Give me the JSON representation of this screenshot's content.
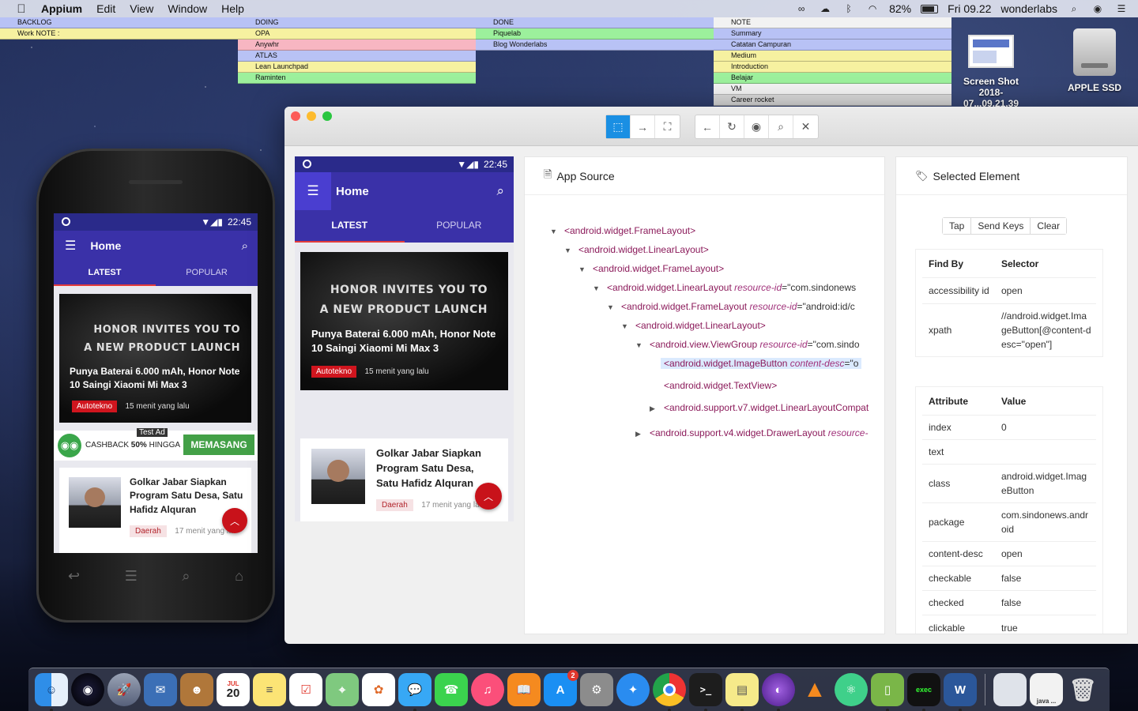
{
  "menubar": {
    "app_name": "Appium",
    "menus": [
      "Edit",
      "View",
      "Window",
      "Help"
    ],
    "battery": "82%",
    "clock": "Fri 09.22",
    "user": "wonderlabs"
  },
  "stickies": [
    {
      "header": "BACKLOG",
      "rows": [
        {
          "text": "Work NOTE :",
          "color": "yellow"
        }
      ]
    },
    {
      "header": "DOING",
      "rows": [
        {
          "text": "OPA",
          "color": "yellow"
        },
        {
          "text": "Anywhr",
          "color": "pink"
        },
        {
          "text": "ATLAS",
          "color": "blue"
        },
        {
          "text": "Lean Launchpad",
          "color": "yellow"
        },
        {
          "text": "Raminten",
          "color": "green"
        }
      ]
    },
    {
      "header": "DONE",
      "rows": [
        {
          "text": "Piquelab",
          "color": "green"
        },
        {
          "text": "Blog Wonderlabs",
          "color": "blue"
        }
      ]
    },
    {
      "header": "NOTE",
      "rows": [
        {
          "text": "Summary",
          "color": "blue"
        },
        {
          "text": "Catatan Campuran",
          "color": "blue"
        },
        {
          "text": "Medium",
          "color": "yellow"
        },
        {
          "text": "Introduction",
          "color": "yellow"
        },
        {
          "text": "Belajar",
          "color": "green"
        },
        {
          "text": "VM",
          "color": "white"
        },
        {
          "text": "Career rocket",
          "color": "gray"
        }
      ]
    }
  ],
  "desktop_icons": {
    "screenshot_line1": "Screen Shot",
    "screenshot_line2": "2018-07...09.21.39",
    "disk": "APPLE SSD"
  },
  "app": {
    "status_time": "22:45",
    "title": "Home",
    "tabs": [
      "LATEST",
      "POPULAR"
    ],
    "promo_line1": "HONOR INVITES YOU TO",
    "promo_line2": "A NEW PRODUCT LAUNCH",
    "headline": "Punya Baterai 6.000 mAh, Honor Note 10 Saingi Xiaomi Mi Max 3",
    "hero_badge": "Autotekno",
    "hero_time": "15 menit yang lalu",
    "ad_label": "Test Ad",
    "ad_text_prefix": "CASHBACK",
    "ad_text_bold": "50%",
    "ad_text_suffix": "HINGGA",
    "ad_button": "MEMASANG",
    "card_title": "Golkar Jabar Siapkan Program Satu Desa, Satu Hafidz Alquran",
    "card_badge": "Daerah",
    "card_time_phone": "17 menit yang la",
    "card_time_preview": "17 menit yang la"
  },
  "inspector": {
    "source_title": "App Source",
    "selected_title": "Selected Element",
    "actions": [
      "Tap",
      "Send Keys",
      "Clear"
    ],
    "findby_headers": {
      "k": "Find By",
      "v": "Selector"
    },
    "findby": [
      {
        "k": "accessibility id",
        "v": "open"
      },
      {
        "k": "xpath",
        "v": "//android.widget.ImageButton[@content-desc=\"open\"]"
      }
    ],
    "attr_headers": {
      "k": "Attribute",
      "v": "Value"
    },
    "attributes": [
      {
        "k": "index",
        "v": "0"
      },
      {
        "k": "text",
        "v": ""
      },
      {
        "k": "class",
        "v": "android.widget.ImageButton"
      },
      {
        "k": "package",
        "v": "com.sindonews.android"
      },
      {
        "k": "content-desc",
        "v": "open"
      },
      {
        "k": "checkable",
        "v": "false"
      },
      {
        "k": "checked",
        "v": "false"
      },
      {
        "k": "clickable",
        "v": "true"
      }
    ],
    "tree": [
      {
        "caret": "▼",
        "tag": "<android.widget.FrameLayout>",
        "attr": "",
        "val": ""
      },
      {
        "caret": "▼",
        "tag": "<android.widget.LinearLayout>",
        "attr": "",
        "val": ""
      },
      {
        "caret": "▼",
        "tag": "<android.widget.FrameLayout>",
        "attr": "",
        "val": ""
      },
      {
        "caret": "▼",
        "tag": "<android.widget.LinearLayout ",
        "attr": "resource-id",
        "val": "=\"com.sindonews"
      },
      {
        "caret": "▼",
        "tag": "<android.widget.FrameLayout ",
        "attr": "resource-id",
        "val": "=\"android:id/c"
      },
      {
        "caret": "▼",
        "tag": "<android.widget.LinearLayout>",
        "attr": "",
        "val": ""
      },
      {
        "caret": "▼",
        "tag": "<android.view.ViewGroup ",
        "attr": "resource-id",
        "val": "=\"com.sindo"
      },
      {
        "caret": "",
        "tag": "<android.widget.ImageButton ",
        "attr": "content-desc",
        "val": "=\"o"
      },
      {
        "caret": "",
        "tag": "<android.widget.TextView>",
        "attr": "",
        "val": ""
      },
      {
        "caret": "▶",
        "tag": "<android.support.v7.widget.LinearLayoutCompat",
        "attr": "",
        "val": ""
      },
      {
        "caret": "▶",
        "tag": "<android.support.v4.widget.DrawerLayout ",
        "attr": "resource-",
        "val": ""
      }
    ]
  },
  "dock": {
    "calendar_month": "JUL",
    "calendar_day": "20",
    "appstore_badge": "2",
    "last_label": "java ..."
  }
}
